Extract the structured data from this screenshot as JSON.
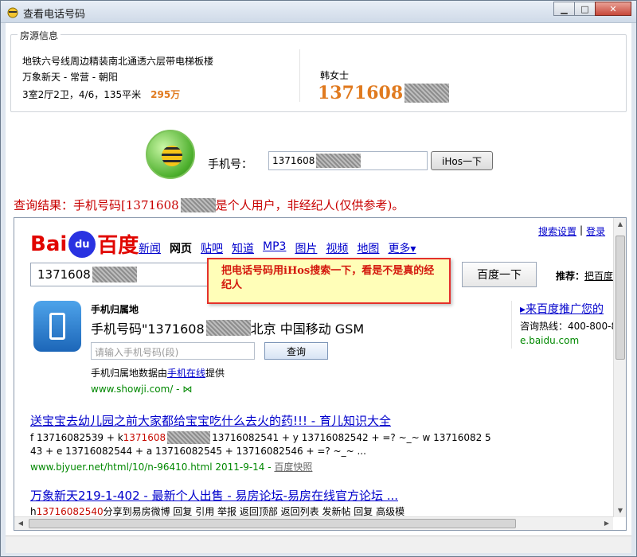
{
  "window": {
    "title": "查看电话号码",
    "controls": {
      "minimize": "▁",
      "maximize": "□",
      "close": "✕"
    }
  },
  "property": {
    "legend": "房源信息",
    "title": "地铁六号线周边精装南北通透六层带电梯板楼",
    "area": "万象新天 - 常营 - 朝阳",
    "spec": "3室2厅2卫，4/6，135平米",
    "price": "295万",
    "contact_name": "韩女士",
    "contact_phone_prefix": "1371608"
  },
  "query": {
    "phone_label": "手机号：",
    "phone_value_prefix": "1371608",
    "button_label": "iHos一下",
    "result_prefix": "查询结果：手机号码[1371608",
    "result_suffix": "是个人用户，非经纪人(仅供参考)。"
  },
  "browser": {
    "logo": {
      "bai": "Bai",
      "du": "du",
      "cn": "百度"
    },
    "nav": [
      "新闻",
      "网页",
      "贴吧",
      "知道",
      "MP3",
      "图片",
      "视频",
      "地图",
      "更多▾"
    ],
    "nav_active": "网页",
    "top_links": [
      "搜索设置",
      "|",
      "登录"
    ],
    "search_value_prefix": "1371608",
    "search_button": "百度一下",
    "recommend_label": "推荐：",
    "recommend_link": "把百度",
    "callout_text": "把电话号码用iHos搜索一下，看是不是真的经纪人",
    "mobile_card": {
      "title": "手机归属地",
      "info_prefix": "手机号码\"1371608",
      "info_suffix": "北京  中国移动  GSM",
      "input_placeholder": "请输入手机号码(段)",
      "query_button": "查询",
      "source_prefix": "手机归属地数据由",
      "source_link": "手机在线",
      "source_suffix": "提供",
      "url": "www.showji.com/ - ⋈"
    },
    "side_ad": {
      "title": "▸来百度推广您的",
      "phone": "咨询热线：400-800-8",
      "url": "e.baidu.com"
    },
    "results": [
      {
        "title": "送宝宝去幼儿园之前大家都给宝宝吃什么去火的药!!! - 育儿知识大全",
        "line1_a": "f 13716082539 + k ",
        "line1_red": "1371608",
        "line1_b": "13716082541 + y 13716082542 + =? ~_~ w 13716082 5",
        "line2": "43 + e 13716082544 + a 13716082545 + 13716082546 + =? ~_~ ...",
        "url": "www.bjyuer.net/html/10/n-96410.html 2011-9-14 - ",
        "cache": "百度快照"
      },
      {
        "title": "万象新天219-1-402 - 最新个人出售 - 易房论坛-易房在线官方论坛 ...",
        "line1_a": "h ",
        "line1_red": "13716082540",
        "line1_b": " 分享到易房微博 回复 引用 举报 返回顶部 返回列表 发新帖 回复 高级模"
      }
    ]
  }
}
